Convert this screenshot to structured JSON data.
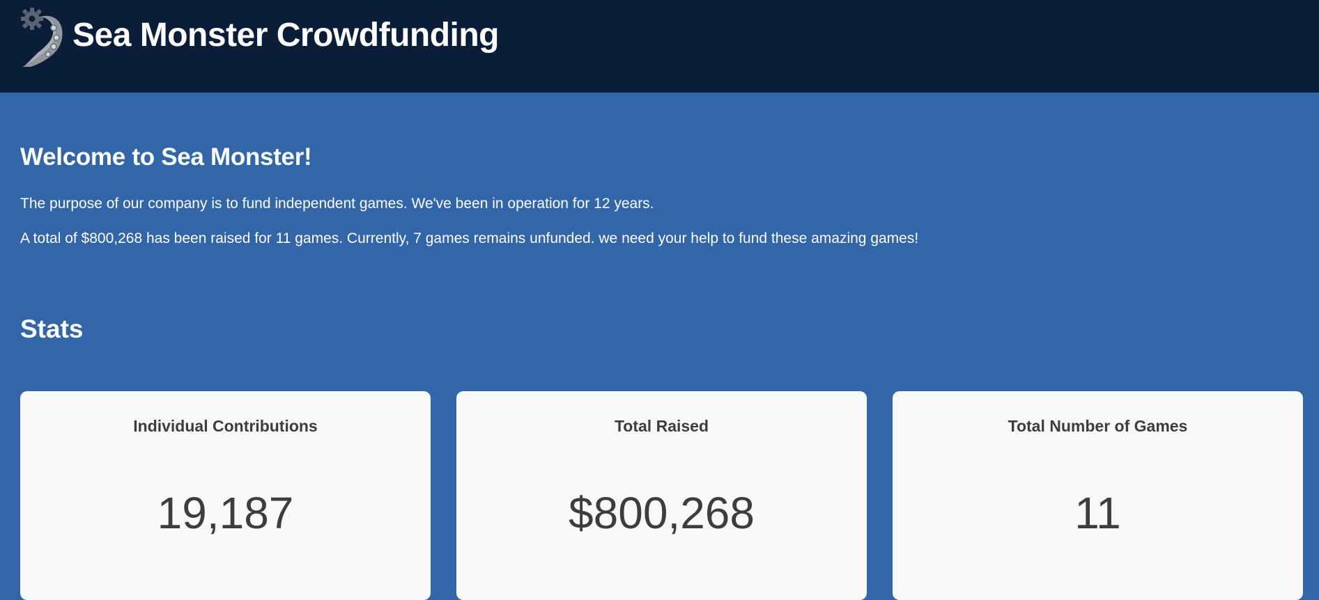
{
  "header": {
    "logo_icon": "sea-monster-tentacle-gear-icon",
    "title": "Sea Monster Crowdfunding"
  },
  "welcome": {
    "heading": "Welcome to Sea Monster!",
    "paragraph_1": "The purpose of our company is to fund independent games. We've been in operation for 12 years.",
    "paragraph_2": "A total of $800,268 has been raised for 11 games. Currently, 7 games remains unfunded. we need your help to fund these amazing games!"
  },
  "stats": {
    "heading": "Stats",
    "cards": [
      {
        "title": "Individual Contributions",
        "value": "19,187"
      },
      {
        "title": "Total Raised",
        "value": "$800,268"
      },
      {
        "title": "Total Number of Games",
        "value": "11"
      }
    ]
  },
  "colors": {
    "header_bg": "#0a1e3a",
    "page_bg": "#3366a8",
    "card_bg": "#f8f8f8",
    "card_text": "#3d3d3d",
    "logo_gray": "#8f969e"
  }
}
